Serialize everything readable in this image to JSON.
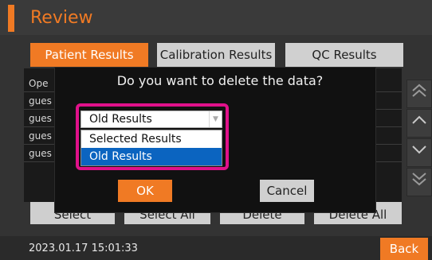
{
  "header": {
    "title": "Review"
  },
  "tabs": [
    {
      "label": "Patient Results",
      "active": true
    },
    {
      "label": "Calibration Results",
      "active": false
    },
    {
      "label": "QC Results",
      "active": false
    }
  ],
  "list": {
    "rows": [
      "Ope",
      "gues",
      "gues",
      "gues",
      "gues"
    ]
  },
  "scroll": {
    "page_up_icon": "double-chevron-up",
    "up_icon": "chevron-up",
    "down_icon": "chevron-down",
    "page_down_icon": "double-chevron-down"
  },
  "actions": {
    "select_label": "Select",
    "select_all_label": "Select All",
    "delete_label": "Delete",
    "delete_all_label": "Delete All"
  },
  "footer": {
    "datetime": "2023.01.17  15:01:33",
    "back_label": "Back"
  },
  "dialog": {
    "question": "Do you want to delete the data?",
    "selected_value": "Old Results",
    "options": [
      {
        "label": "Selected Results",
        "highlighted": false
      },
      {
        "label": "Old Results",
        "highlighted": true
      }
    ],
    "ok_label": "OK",
    "cancel_label": "Cancel"
  },
  "colors": {
    "accent": "#f07a24",
    "highlight_border": "#e0118a",
    "selected_option": "#0b64c0",
    "background": "#333333"
  }
}
